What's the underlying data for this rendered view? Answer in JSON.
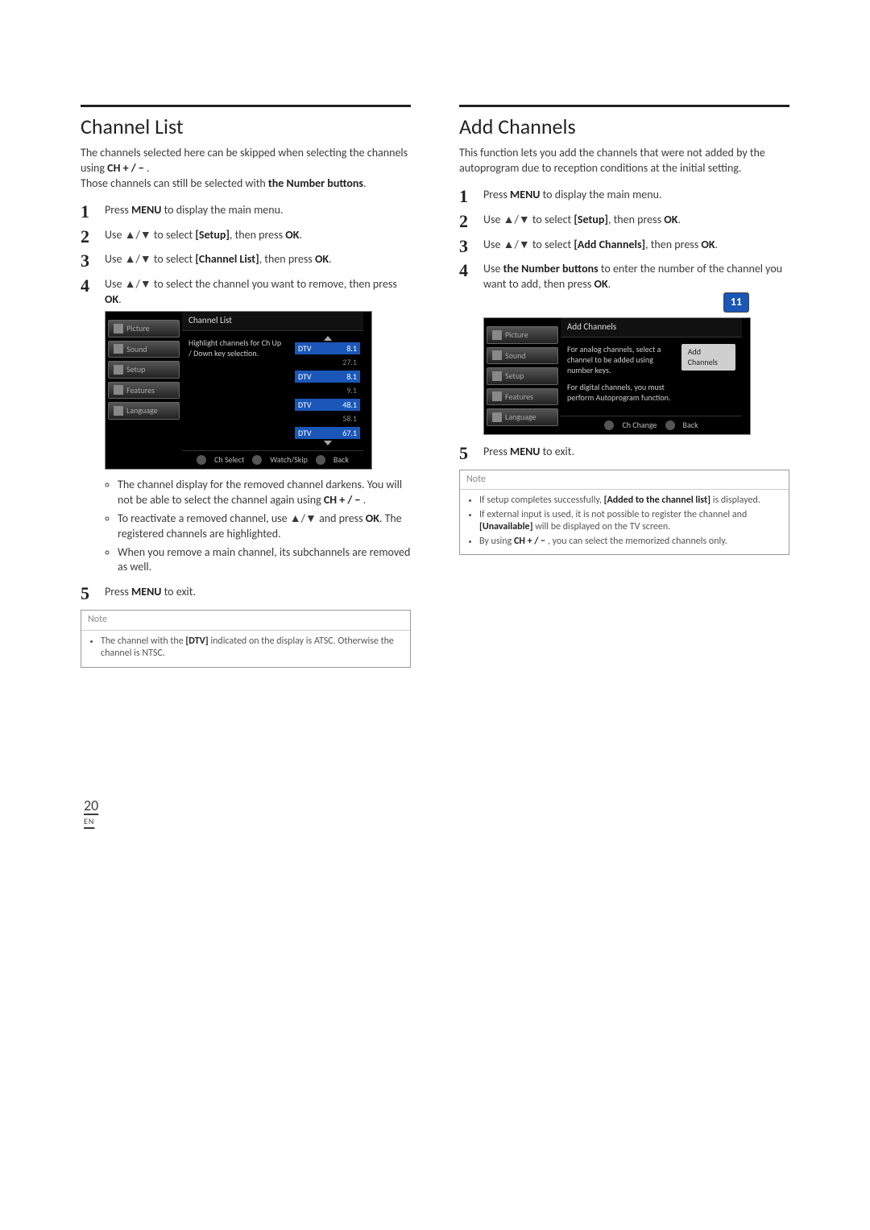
{
  "page_number": "20",
  "page_lang": "EN",
  "left": {
    "title": "Channel List",
    "intro1": "The channels selected here can be skipped when selecting the channels using ",
    "intro1_bold": "CH + / −",
    "intro1_end": " .",
    "intro2a": "Those channels can still be selected with ",
    "intro2b": "the Number buttons",
    "intro2c": ".",
    "steps": [
      {
        "pre": "Press ",
        "b": "MENU",
        "post": " to display the main menu."
      },
      {
        "pre": "Use ▲/▼ to select ",
        "b": "[Setup]",
        "post": ", then press ",
        "b2": "OK",
        "post2": "."
      },
      {
        "pre": "Use ▲/▼ to select ",
        "b": "[Channel List]",
        "post": ", then press ",
        "b2": "OK",
        "post2": "."
      },
      {
        "pre": "Use ▲/▼ to select the channel you want to remove, then press ",
        "b": "OK",
        "post": "."
      }
    ],
    "panel_title": "Channel List",
    "hint": "Highlight channels for Ch Up / Down key selection.",
    "channels": [
      {
        "tag": "DTV",
        "num": "8.1",
        "hl": true
      },
      {
        "tag": "",
        "num": "27.1",
        "hl": false
      },
      {
        "tag": "DTV",
        "num": "8.1",
        "hl": true
      },
      {
        "tag": "",
        "num": "9.1",
        "hl": false
      },
      {
        "tag": "DTV",
        "num": "48.1",
        "hl": true
      },
      {
        "tag": "",
        "num": "58.1",
        "hl": false
      },
      {
        "tag": "DTV",
        "num": "67.1",
        "hl": true
      }
    ],
    "foot": [
      "Ch Select",
      "Watch/Skip",
      "Back"
    ],
    "bullets": [
      {
        "a": "The channel display for the removed channel darkens. You will not be able to select the channel again using ",
        "b": "CH + / −",
        "c": " ."
      },
      {
        "a": "To reactivate a removed channel, use ▲/▼ and press ",
        "b": "OK",
        "c": ". The registered channels are highlighted."
      },
      {
        "a": "When you remove a main channel, its subchannels are removed as well.",
        "b": "",
        "c": ""
      }
    ],
    "step5_pre": "Press ",
    "step5_b": "MENU",
    "step5_post": " to exit.",
    "note_head": "Note",
    "note_items": [
      {
        "a": "The channel with the ",
        "b": "[DTV]",
        "c": " indicated on the display is ATSC. Otherwise the channel is NTSC."
      }
    ],
    "sidebar": [
      "Picture",
      "Sound",
      "Setup",
      "Features",
      "Language"
    ]
  },
  "right": {
    "title": "Add Channels",
    "intro": "This function lets you add the channels that were not added by the autoprogram due to reception conditions at the initial setting.",
    "steps": [
      {
        "pre": "Press ",
        "b": "MENU",
        "post": " to display the main menu."
      },
      {
        "pre": "Use ▲/▼ to select ",
        "b": "[Setup]",
        "post": ", then press ",
        "b2": "OK",
        "post2": "."
      },
      {
        "pre": "Use ▲/▼ to select ",
        "b": "[Add Channels]",
        "post": ", then press ",
        "b2": "OK",
        "post2": "."
      },
      {
        "pre": "Use ",
        "b": "the Number buttons",
        "post": " to enter the number of the channel you want to add, then press ",
        "b2": "OK",
        "post2": "."
      }
    ],
    "badge": "11",
    "panel_title": "Add Channels",
    "hint1": "For analog channels, select a channel to be added using number keys.",
    "hint2": "For digital channels, you must perform Autoprogram function.",
    "add_btn": "Add Channels",
    "foot": [
      "Ch Change",
      "Back"
    ],
    "step5_pre": "Press ",
    "step5_b": "MENU",
    "step5_post": " to exit.",
    "note_head": "Note",
    "note_items": [
      {
        "a": "If setup completes successfully, ",
        "b": "[Added to the channel list]",
        "c": " is displayed."
      },
      {
        "a": "If external input is used, it is not possible to register the channel and ",
        "b": "[Unavailable]",
        "c": " will be displayed on the TV screen."
      },
      {
        "a": "By using ",
        "b": "CH + / −",
        "c": " , you can select the memorized channels only."
      }
    ],
    "sidebar": [
      "Picture",
      "Sound",
      "Setup",
      "Features",
      "Language"
    ]
  }
}
